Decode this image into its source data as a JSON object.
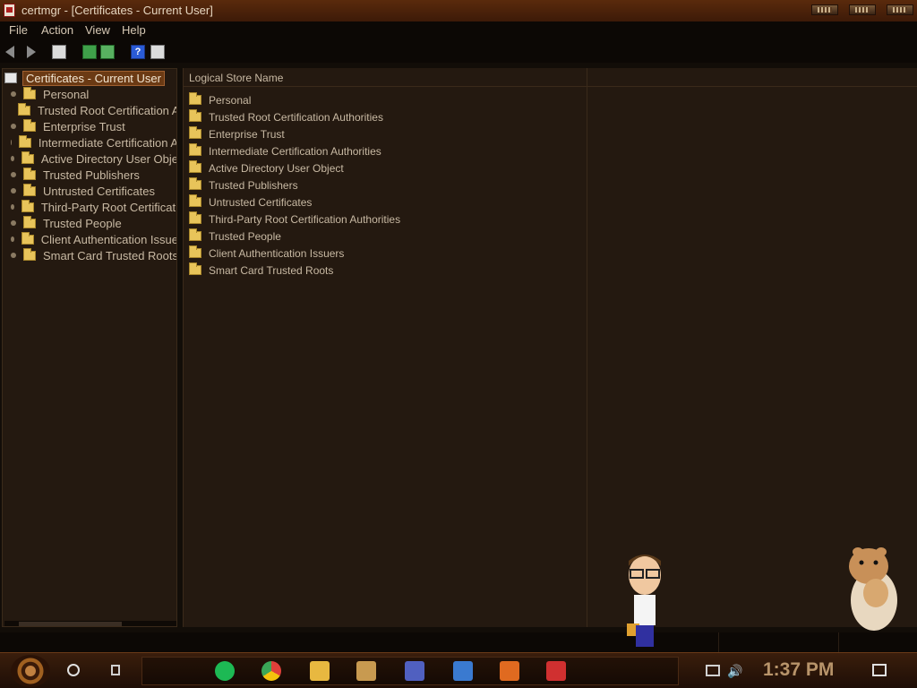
{
  "window": {
    "title": "certmgr - [Certificates - Current User]"
  },
  "menu": [
    "File",
    "Action",
    "View",
    "Help"
  ],
  "toolbar": {
    "buttons": [
      "back-icon",
      "forward-icon",
      "show-hide-console-tree-icon",
      "refresh-icon",
      "export-list-icon",
      "help-icon",
      "properties-icon"
    ]
  },
  "tree": {
    "root": "Certificates - Current User",
    "items": [
      "Personal",
      "Trusted Root Certification A",
      "Enterprise Trust",
      "Intermediate Certification A",
      "Active Directory User Obje",
      "Trusted Publishers",
      "Untrusted Certificates",
      "Third-Party Root Certificati",
      "Trusted People",
      "Client Authentication Issue",
      "Smart Card Trusted Roots"
    ]
  },
  "list": {
    "column_header": "Logical Store Name",
    "items": [
      "Personal",
      "Trusted Root Certification Authorities",
      "Enterprise Trust",
      "Intermediate Certification Authorities",
      "Active Directory User Object",
      "Trusted Publishers",
      "Untrusted Certificates",
      "Third-Party Root Certification Authorities",
      "Trusted People",
      "Client Authentication Issuers",
      "Smart Card Trusted Roots"
    ]
  },
  "taskbar": {
    "apps": [
      "spotify-icon",
      "chrome-icon",
      "file-explorer-icon",
      "sandbox-app-icon",
      "network-tool-icon",
      "virtualbox-icon",
      "java-icon",
      "toolbox-icon"
    ],
    "clock": "1:37 PM"
  },
  "colors": {
    "accent": "#6b3a14",
    "background": "#241910",
    "text": "#c8b9a3",
    "clock": "#b8946a"
  }
}
